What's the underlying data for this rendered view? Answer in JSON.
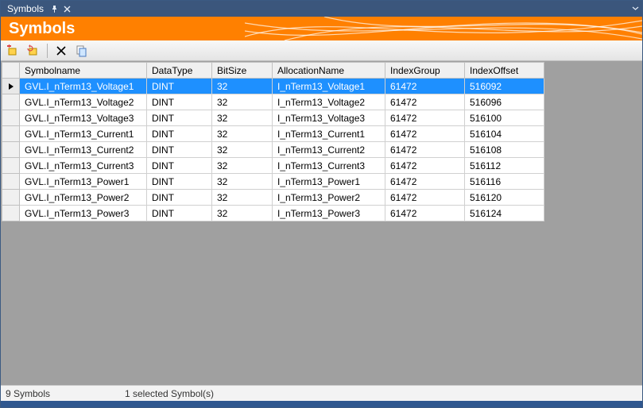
{
  "titlebar": {
    "title": "Symbols"
  },
  "banner": {
    "heading": "Symbols"
  },
  "toolbar_icons": {
    "add": "add-symbol-icon",
    "refresh": "refresh-icon",
    "delete": "delete-icon",
    "copy": "copy-icon"
  },
  "columns": {
    "rowhdr": "",
    "symbolname": "Symbolname",
    "datatype": "DataType",
    "bitsize": "BitSize",
    "allocationname": "AllocationName",
    "indexgroup": "IndexGroup",
    "indexoffset": "IndexOffset"
  },
  "rows": [
    {
      "selected": true,
      "symbolname": "GVL.I_nTerm13_Voltage1",
      "datatype": "DINT",
      "bitsize": "32",
      "allocationname": "I_nTerm13_Voltage1",
      "indexgroup": "61472",
      "indexoffset": "516092"
    },
    {
      "selected": false,
      "symbolname": "GVL.I_nTerm13_Voltage2",
      "datatype": "DINT",
      "bitsize": "32",
      "allocationname": "I_nTerm13_Voltage2",
      "indexgroup": "61472",
      "indexoffset": "516096"
    },
    {
      "selected": false,
      "symbolname": "GVL.I_nTerm13_Voltage3",
      "datatype": "DINT",
      "bitsize": "32",
      "allocationname": "I_nTerm13_Voltage3",
      "indexgroup": "61472",
      "indexoffset": "516100"
    },
    {
      "selected": false,
      "symbolname": "GVL.I_nTerm13_Current1",
      "datatype": "DINT",
      "bitsize": "32",
      "allocationname": "I_nTerm13_Current1",
      "indexgroup": "61472",
      "indexoffset": "516104"
    },
    {
      "selected": false,
      "symbolname": "GVL.I_nTerm13_Current2",
      "datatype": "DINT",
      "bitsize": "32",
      "allocationname": "I_nTerm13_Current2",
      "indexgroup": "61472",
      "indexoffset": "516108"
    },
    {
      "selected": false,
      "symbolname": "GVL.I_nTerm13_Current3",
      "datatype": "DINT",
      "bitsize": "32",
      "allocationname": "I_nTerm13_Current3",
      "indexgroup": "61472",
      "indexoffset": "516112"
    },
    {
      "selected": false,
      "symbolname": "GVL.I_nTerm13_Power1",
      "datatype": "DINT",
      "bitsize": "32",
      "allocationname": "I_nTerm13_Power1",
      "indexgroup": "61472",
      "indexoffset": "516116"
    },
    {
      "selected": false,
      "symbolname": "GVL.I_nTerm13_Power2",
      "datatype": "DINT",
      "bitsize": "32",
      "allocationname": "I_nTerm13_Power2",
      "indexgroup": "61472",
      "indexoffset": "516120"
    },
    {
      "selected": false,
      "symbolname": "GVL.I_nTerm13_Power3",
      "datatype": "DINT",
      "bitsize": "32",
      "allocationname": "I_nTerm13_Power3",
      "indexgroup": "61472",
      "indexoffset": "516124"
    }
  ],
  "status": {
    "count_text": "9 Symbols",
    "selection_text": "1 selected Symbol(s)"
  }
}
